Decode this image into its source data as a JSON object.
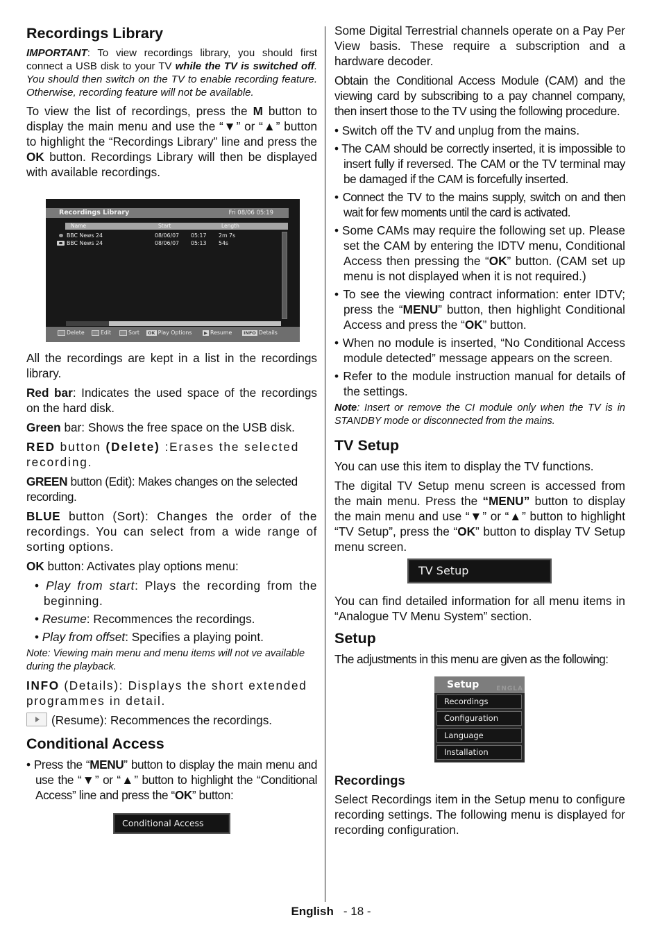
{
  "left": {
    "recordings_library": {
      "heading": "Recordings Library",
      "important": {
        "label": "IMPORTANT",
        "text1": ": To view recordings library, you should first connect a USB disk to your TV ",
        "bold_italic": "while the TV is switched off",
        "text2": ". You should then switch on the TV to enable recording feature. Otherwise, recording feature will not be available."
      },
      "intro": {
        "t1": "To view the list of recordings, press the ",
        "b1": "M",
        "t2": " button to display the main menu and use the “",
        "down": "▼",
        "t3": "” or “",
        "up": "▲",
        "t4": "” button to highlight the “Recordings Library” line and press the ",
        "b2": "OK",
        "t5": " button. Recordings Library will then be displayed with available recordings."
      },
      "screen": {
        "title": "Recordings Library",
        "datetime": "Fri 08/06 05:19",
        "columns": [
          "Name",
          "Start",
          "Length"
        ],
        "rows": [
          {
            "icon": "dot-icon",
            "name": "BBC News 24",
            "date": "08/06/07",
            "time": "05:17",
            "length": "2m 7s"
          },
          {
            "icon": "eye-icon",
            "name": "BBC News 24",
            "date": "08/06/07",
            "time": "05:13",
            "length": "54s"
          }
        ],
        "disk_used_fraction": 0.2,
        "footer": [
          {
            "key": "red-box",
            "label": "Delete"
          },
          {
            "key": "green-box",
            "label": "Edit"
          },
          {
            "key": "blue-box",
            "label": "Sort"
          },
          {
            "key": "OK",
            "label": "Play Options"
          },
          {
            "key": "▶",
            "label": "Resume"
          },
          {
            "key": "INFO",
            "label": "Details"
          }
        ]
      },
      "all_kept": "All the recordings are kept in a list in the recordings library.",
      "red_bar": {
        "b": "Red bar",
        "t": ": Indicates the used space of the recordings on the hard disk."
      },
      "green_bar": {
        "b": "Green",
        "t": " bar: Shows the free space on the USB  disk."
      },
      "red_button": {
        "b1": "RED",
        "t1": " button ",
        "b2": "(Delete)",
        "t2": " :Erases the selected recording."
      },
      "green_button": {
        "b": "GREEN",
        "t": " button (Edit): Makes changes on the selected recording."
      },
      "blue_button": {
        "b": "BLUE",
        "t": " button (Sort): Changes the order of the recordings. You can select from a wide range of sorting options."
      },
      "ok_button": {
        "b": "OK",
        "t": " button: Activates play options menu:"
      },
      "play_options": [
        {
          "i": "Play from start",
          "t": ": Plays the recording from the beginning."
        },
        {
          "i": "Resume",
          "t": ": Recommences the recordings."
        },
        {
          "i": "Play from offset",
          "t": ": Specifies a playing point."
        }
      ],
      "note": "Note: Viewing main menu and menu items will not ve available during the playback.",
      "info": {
        "b": "INFO",
        "t": " (Details): Displays the short extended programmes in detail."
      },
      "resume": "(Resume): Recommences the recordings."
    },
    "conditional_access": {
      "heading": "Conditional Access",
      "step": {
        "t1": "Press the “",
        "b1": "MENU",
        "t2": "” button to display the main menu and use the “",
        "down": "▼",
        "t3": "” or “",
        "up": "▲",
        "t4": "” button to highlight the “Conditional Access” line and press the “",
        "b2": "OK",
        "t5": "” button:"
      },
      "banner": "Conditional Access"
    }
  },
  "right": {
    "ca_intro1": "Some Digital Terrestrial channels operate on a Pay Per View basis. These require a subscription and a hardware decoder.",
    "ca_intro2": "Obtain the Conditional Access Module (CAM) and the viewing card by subscribing to a pay channel company, then insert those to the TV using the following procedure.",
    "bullets": {
      "b1": "Switch off the TV and unplug from the mains.",
      "b2": "The CAM should be correctly inserted, it is impossible to insert fully if reversed. The CAM or the TV terminal may be damaged if the CAM is forcefully inserted.",
      "b3": "Connect the TV to the mains supply, switch on and then wait for few moments until the card is activated.",
      "b4": {
        "t1": "Some CAMs may require the following set up. Please set the CAM by entering the IDTV menu, Conditional Access then pressing the “",
        "b": "OK",
        "t2": "” button. (CAM set up menu is not displayed when it is not required.)"
      },
      "b5": {
        "t1": "To see the viewing contract information: enter IDTV; press the “",
        "b1": "MENU",
        "t2": "” button, then highlight Conditional Access and press the “",
        "b2": "OK",
        "t3": "” button."
      },
      "b6": "When no module is inserted, “No Conditional Access module detected” message appears on the screen.",
      "b7": "Refer to the module instruction manual for details of the settings."
    },
    "note": {
      "b": "Note",
      "t": ": Insert or remove the CI module only when the TV is in STANDBY mode or disconnected from the mains."
    },
    "tv_setup": {
      "heading": "TV Setup",
      "p1": "You can use this item to display the TV functions.",
      "p2": {
        "t1": "The digital TV Setup menu screen is accessed from the main menu. Press the ",
        "b1": "“MENU”",
        "t2": " button to display the main menu and use “",
        "down": "▼",
        "t3": "” or “",
        "up": "▲",
        "t4": "” button to highlight “TV Setup”, press the “",
        "b2": "OK",
        "t5": "” button to display TV Setup menu screen."
      },
      "banner": "TV Setup",
      "p3": "You can find detailed information for all menu items in “Analogue TV Menu System” section."
    },
    "setup": {
      "heading": "Setup",
      "p1": "The adjustments in this menu are given as the following:",
      "menu_title": "Setup",
      "menu_ghost": "ENGLA",
      "menu_items": [
        "Recordings",
        "Configuration",
        "Language",
        "Installation"
      ]
    },
    "recordings": {
      "heading": "Recordings",
      "p1": "Select Recordings item in the Setup menu to configure recording settings. The following menu is displayed for recording configuration."
    }
  },
  "footer": {
    "language": "English",
    "page": "- 18 -"
  }
}
